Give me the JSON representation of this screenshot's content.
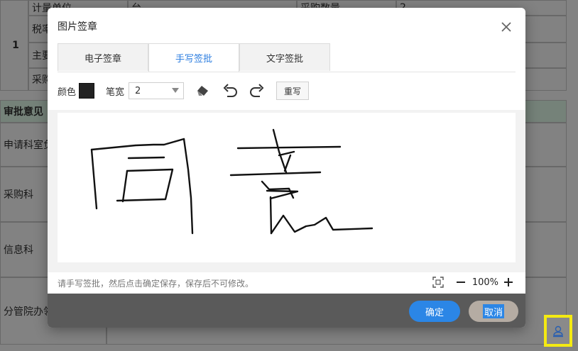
{
  "background_form": {
    "row_number": "1",
    "fields": [
      "计量单位",
      "台",
      "采购数量",
      "2",
      "税率",
      "主要",
      "采购"
    ],
    "section_header": "审批意见",
    "approvers": [
      "申请科室负",
      "采购科",
      "信息科",
      "分管院办领"
    ]
  },
  "dialog": {
    "title": "图片签章",
    "tabs": [
      {
        "label": "电子签章",
        "active": false
      },
      {
        "label": "手写签批",
        "active": true
      },
      {
        "label": "文字签批",
        "active": false
      }
    ],
    "toolbar": {
      "color_label": "颜色",
      "color_value": "#222222",
      "width_label": "笔宽",
      "width_value": "2",
      "icons": [
        "eraser-icon",
        "undo-icon",
        "redo-icon"
      ],
      "rewrite_label": "重写"
    },
    "signature_text": "同意",
    "hint": "请手写签批，然后点击确定保存，保存后不可修改。",
    "zoom": {
      "value": "100%"
    },
    "confirm_label": "确定",
    "cancel_label": "取消"
  },
  "colors": {
    "accent": "#2b86e6",
    "highlight": "#f4ea12",
    "cancel": "#b5aca3"
  }
}
